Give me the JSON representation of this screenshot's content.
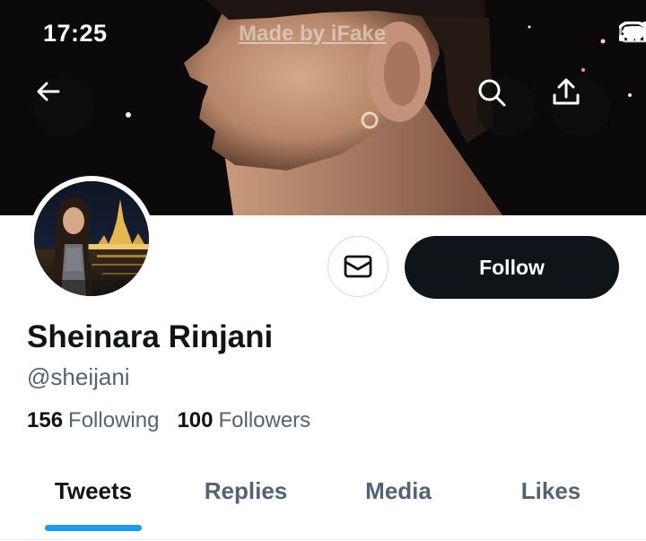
{
  "status_bar": {
    "time": "17:25",
    "watermark": "Made by iFake",
    "icons": [
      "cellular-signal-icon",
      "wifi-icon",
      "battery-icon"
    ]
  },
  "header": {
    "back_icon": "arrow-left-icon",
    "search_icon": "search-icon",
    "share_icon": "share-upload-icon"
  },
  "profile": {
    "display_name": "Sheinara Rinjani",
    "handle": "@sheijani",
    "following_count": "156",
    "following_label": "Following",
    "followers_count": "100",
    "followers_label": "Followers"
  },
  "actions": {
    "message_icon": "mail-icon",
    "follow_label": "Follow"
  },
  "tabs": [
    {
      "label": "Tweets",
      "active": true
    },
    {
      "label": "Replies",
      "active": false
    },
    {
      "label": "Media",
      "active": false
    },
    {
      "label": "Likes",
      "active": false
    }
  ],
  "colors": {
    "accent": "#1d9bf0",
    "text_primary": "#0f1419",
    "text_secondary": "#536471",
    "follow_button_bg": "#0f1419"
  }
}
